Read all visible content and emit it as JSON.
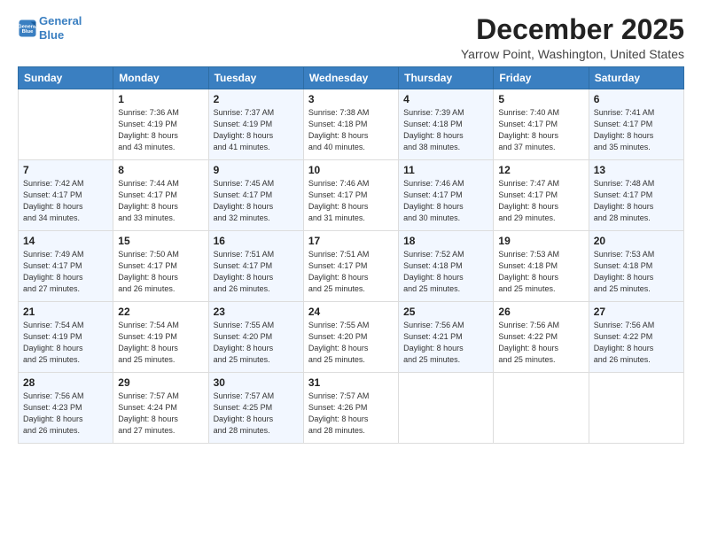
{
  "logo": {
    "line1": "General",
    "line2": "Blue"
  },
  "header": {
    "month": "December 2025",
    "location": "Yarrow Point, Washington, United States"
  },
  "weekdays": [
    "Sunday",
    "Monday",
    "Tuesday",
    "Wednesday",
    "Thursday",
    "Friday",
    "Saturday"
  ],
  "weeks": [
    [
      {
        "day": "",
        "detail": ""
      },
      {
        "day": "1",
        "detail": "Sunrise: 7:36 AM\nSunset: 4:19 PM\nDaylight: 8 hours\nand 43 minutes."
      },
      {
        "day": "2",
        "detail": "Sunrise: 7:37 AM\nSunset: 4:19 PM\nDaylight: 8 hours\nand 41 minutes."
      },
      {
        "day": "3",
        "detail": "Sunrise: 7:38 AM\nSunset: 4:18 PM\nDaylight: 8 hours\nand 40 minutes."
      },
      {
        "day": "4",
        "detail": "Sunrise: 7:39 AM\nSunset: 4:18 PM\nDaylight: 8 hours\nand 38 minutes."
      },
      {
        "day": "5",
        "detail": "Sunrise: 7:40 AM\nSunset: 4:17 PM\nDaylight: 8 hours\nand 37 minutes."
      },
      {
        "day": "6",
        "detail": "Sunrise: 7:41 AM\nSunset: 4:17 PM\nDaylight: 8 hours\nand 35 minutes."
      }
    ],
    [
      {
        "day": "7",
        "detail": "Sunrise: 7:42 AM\nSunset: 4:17 PM\nDaylight: 8 hours\nand 34 minutes."
      },
      {
        "day": "8",
        "detail": "Sunrise: 7:44 AM\nSunset: 4:17 PM\nDaylight: 8 hours\nand 33 minutes."
      },
      {
        "day": "9",
        "detail": "Sunrise: 7:45 AM\nSunset: 4:17 PM\nDaylight: 8 hours\nand 32 minutes."
      },
      {
        "day": "10",
        "detail": "Sunrise: 7:46 AM\nSunset: 4:17 PM\nDaylight: 8 hours\nand 31 minutes."
      },
      {
        "day": "11",
        "detail": "Sunrise: 7:46 AM\nSunset: 4:17 PM\nDaylight: 8 hours\nand 30 minutes."
      },
      {
        "day": "12",
        "detail": "Sunrise: 7:47 AM\nSunset: 4:17 PM\nDaylight: 8 hours\nand 29 minutes."
      },
      {
        "day": "13",
        "detail": "Sunrise: 7:48 AM\nSunset: 4:17 PM\nDaylight: 8 hours\nand 28 minutes."
      }
    ],
    [
      {
        "day": "14",
        "detail": "Sunrise: 7:49 AM\nSunset: 4:17 PM\nDaylight: 8 hours\nand 27 minutes."
      },
      {
        "day": "15",
        "detail": "Sunrise: 7:50 AM\nSunset: 4:17 PM\nDaylight: 8 hours\nand 26 minutes."
      },
      {
        "day": "16",
        "detail": "Sunrise: 7:51 AM\nSunset: 4:17 PM\nDaylight: 8 hours\nand 26 minutes."
      },
      {
        "day": "17",
        "detail": "Sunrise: 7:51 AM\nSunset: 4:17 PM\nDaylight: 8 hours\nand 25 minutes."
      },
      {
        "day": "18",
        "detail": "Sunrise: 7:52 AM\nSunset: 4:18 PM\nDaylight: 8 hours\nand 25 minutes."
      },
      {
        "day": "19",
        "detail": "Sunrise: 7:53 AM\nSunset: 4:18 PM\nDaylight: 8 hours\nand 25 minutes."
      },
      {
        "day": "20",
        "detail": "Sunrise: 7:53 AM\nSunset: 4:18 PM\nDaylight: 8 hours\nand 25 minutes."
      }
    ],
    [
      {
        "day": "21",
        "detail": "Sunrise: 7:54 AM\nSunset: 4:19 PM\nDaylight: 8 hours\nand 25 minutes."
      },
      {
        "day": "22",
        "detail": "Sunrise: 7:54 AM\nSunset: 4:19 PM\nDaylight: 8 hours\nand 25 minutes."
      },
      {
        "day": "23",
        "detail": "Sunrise: 7:55 AM\nSunset: 4:20 PM\nDaylight: 8 hours\nand 25 minutes."
      },
      {
        "day": "24",
        "detail": "Sunrise: 7:55 AM\nSunset: 4:20 PM\nDaylight: 8 hours\nand 25 minutes."
      },
      {
        "day": "25",
        "detail": "Sunrise: 7:56 AM\nSunset: 4:21 PM\nDaylight: 8 hours\nand 25 minutes."
      },
      {
        "day": "26",
        "detail": "Sunrise: 7:56 AM\nSunset: 4:22 PM\nDaylight: 8 hours\nand 25 minutes."
      },
      {
        "day": "27",
        "detail": "Sunrise: 7:56 AM\nSunset: 4:22 PM\nDaylight: 8 hours\nand 26 minutes."
      }
    ],
    [
      {
        "day": "28",
        "detail": "Sunrise: 7:56 AM\nSunset: 4:23 PM\nDaylight: 8 hours\nand 26 minutes."
      },
      {
        "day": "29",
        "detail": "Sunrise: 7:57 AM\nSunset: 4:24 PM\nDaylight: 8 hours\nand 27 minutes."
      },
      {
        "day": "30",
        "detail": "Sunrise: 7:57 AM\nSunset: 4:25 PM\nDaylight: 8 hours\nand 28 minutes."
      },
      {
        "day": "31",
        "detail": "Sunrise: 7:57 AM\nSunset: 4:26 PM\nDaylight: 8 hours\nand 28 minutes."
      },
      {
        "day": "",
        "detail": ""
      },
      {
        "day": "",
        "detail": ""
      },
      {
        "day": "",
        "detail": ""
      }
    ]
  ]
}
